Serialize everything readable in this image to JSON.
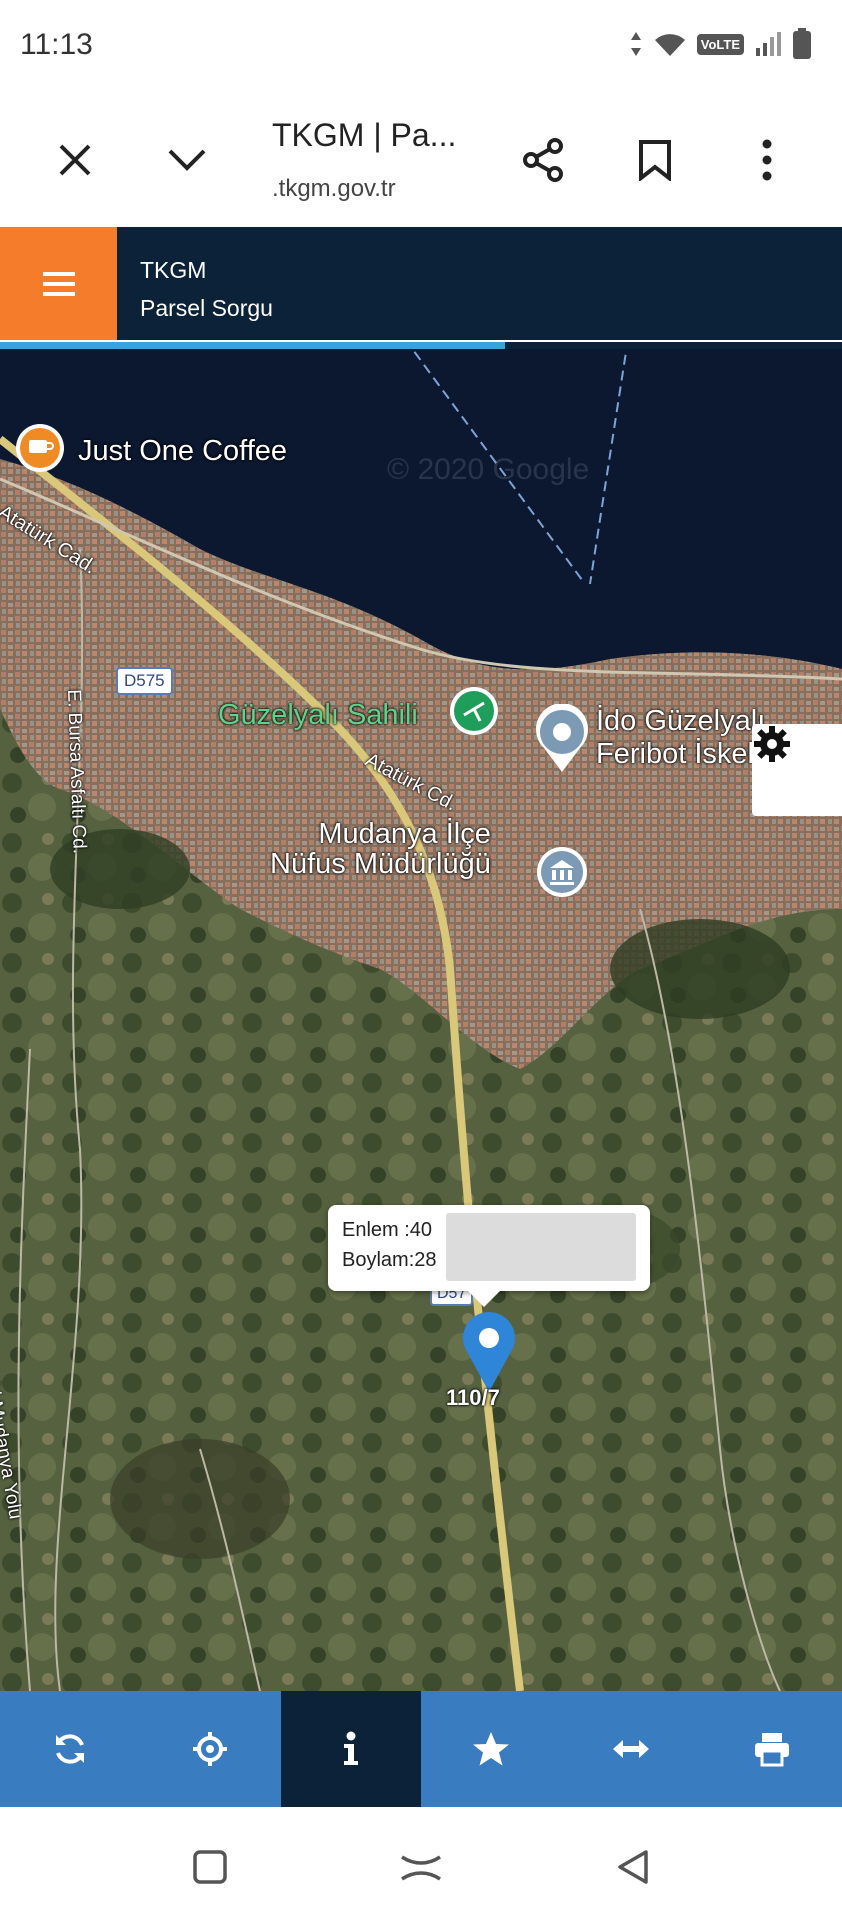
{
  "status_bar": {
    "time": "11:13",
    "network_badge": "VoLTE"
  },
  "browser": {
    "title": "TKGM | Pa...",
    "url": ".tkgm.gov.tr",
    "icons": [
      "close-icon",
      "chevron-down-icon",
      "share-icon",
      "bookmark-icon",
      "more-vert-icon"
    ]
  },
  "app_header": {
    "title": "TKGM",
    "subtitle": "Parsel Sorgu",
    "menu_icon": "hamburger-icon",
    "accent_color": "#f57c2b",
    "header_color": "#0c2238",
    "progress_fraction": 0.6
  },
  "map": {
    "labels": {
      "coffee": "Just One Coffee",
      "ataturk_cad_1": "Atatürk Cad.",
      "ataturk_cad_2": "Atatürk Cd.",
      "d575_1": "D575",
      "d575_2": "D57",
      "guzelyali_sahili": "Güzelyalı Sahili",
      "ido_line1": "İdo Güzelyalı",
      "ido_line2": "Feribot İskelesi",
      "mudanya_line1": "Mudanya İlçe",
      "mudanya_line2": "Nüfus Müdürlüğü",
      "bursa_asfalti": "E. Bursa Asfaltı Cd.",
      "mudanya_yolu": "Eski Mudanya Yolu",
      "copyright": "© 2020 Google"
    },
    "settings_icon": "gear-icon",
    "popup": {
      "lat_label": "Enlem  :40",
      "lon_label": "Boylam:28"
    },
    "parcel_label": "110/7"
  },
  "toolbar": {
    "tools": [
      {
        "icon": "refresh-icon"
      },
      {
        "icon": "crosshair-icon"
      },
      {
        "icon": "info-icon",
        "active": true
      },
      {
        "icon": "star-icon"
      },
      {
        "icon": "measure-icon"
      },
      {
        "icon": "print-icon"
      }
    ],
    "color": "#3a7cc0"
  },
  "navbar": {
    "icons": [
      "recents-icon",
      "home-icon",
      "back-icon"
    ]
  }
}
